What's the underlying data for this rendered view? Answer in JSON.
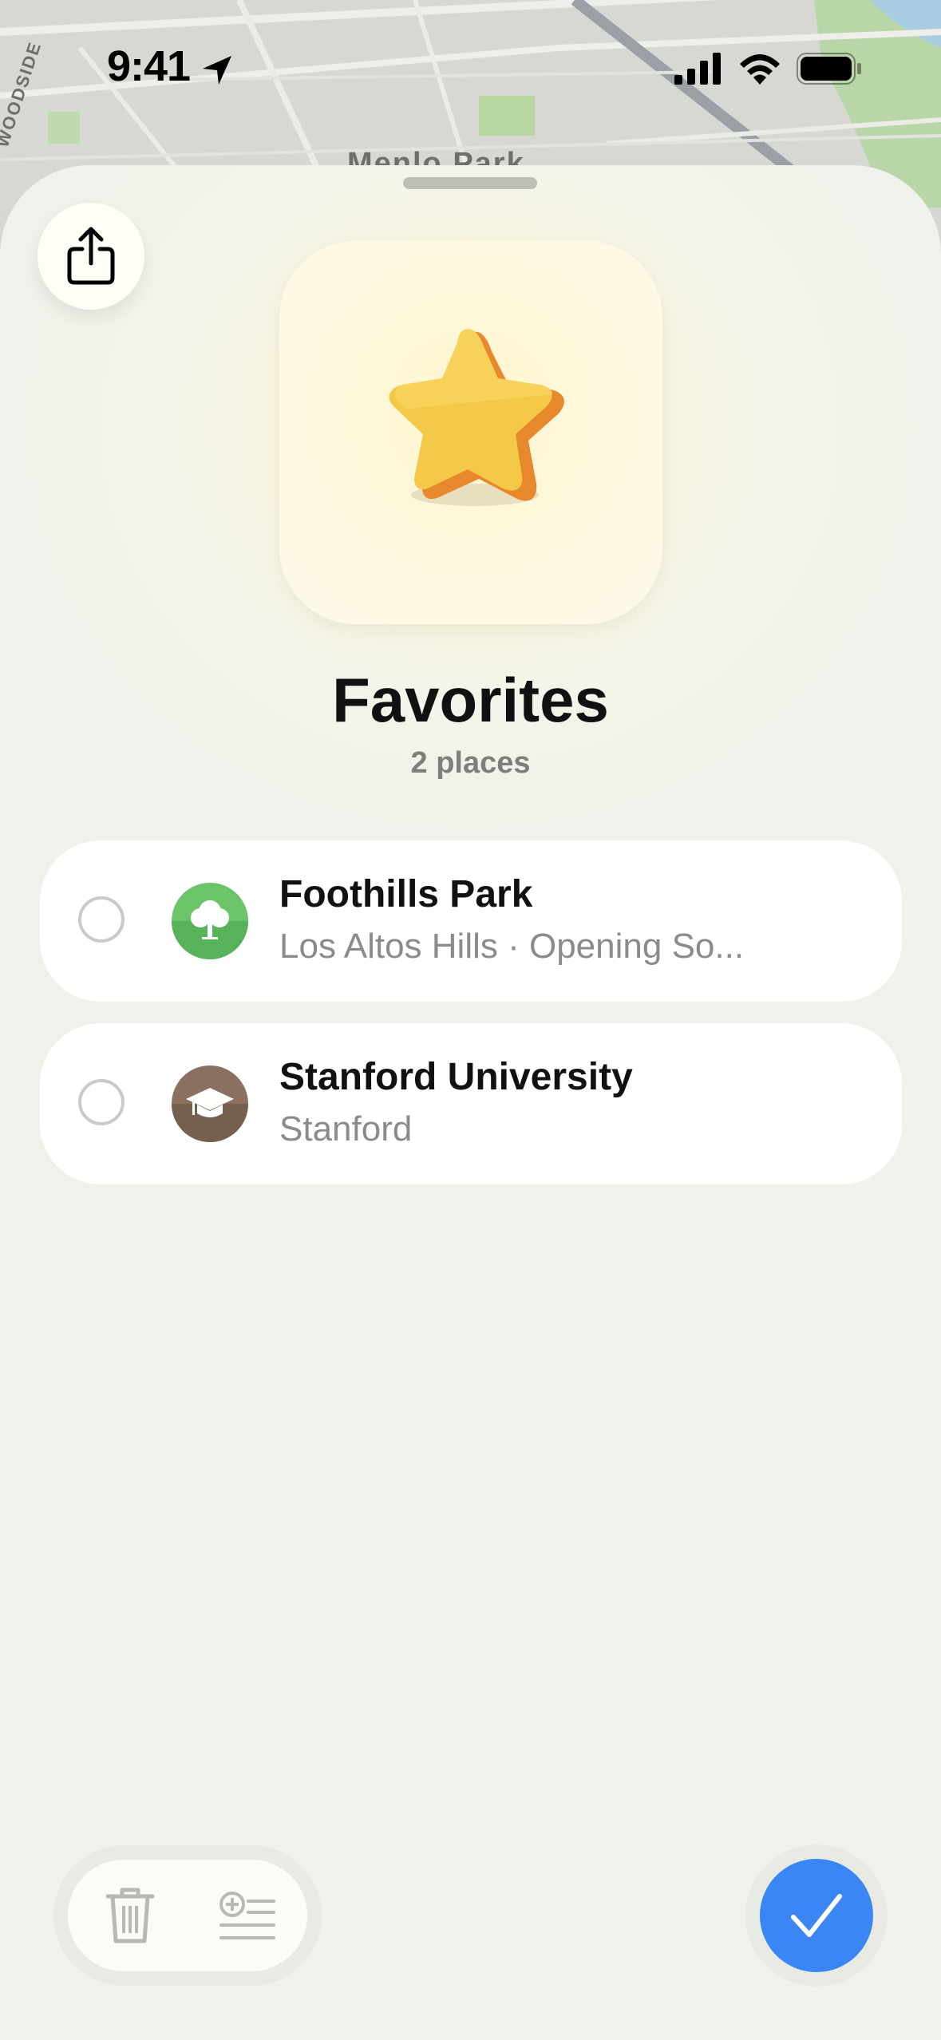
{
  "status_bar": {
    "time": "9:41"
  },
  "map": {
    "labels": [
      "WOODSIDE",
      "Menlo Park"
    ]
  },
  "sheet": {
    "title": "Favorites",
    "subtitle": "2 places",
    "icon": "star-icon"
  },
  "places": [
    {
      "name": "Foothills Park",
      "detail": "Los Altos Hills · Opening So...",
      "icon": "tree-icon",
      "icon_color": "#5cb85c",
      "selected": false
    },
    {
      "name": "Stanford University",
      "detail": "Stanford",
      "icon": "graduation-cap-icon",
      "icon_color": "#7a6354",
      "selected": false
    }
  ],
  "toolbar": {
    "delete_icon": "trash-icon",
    "add_note_icon": "add-note-icon",
    "done_icon": "checkmark-icon",
    "done_color": "#3a86f4"
  }
}
